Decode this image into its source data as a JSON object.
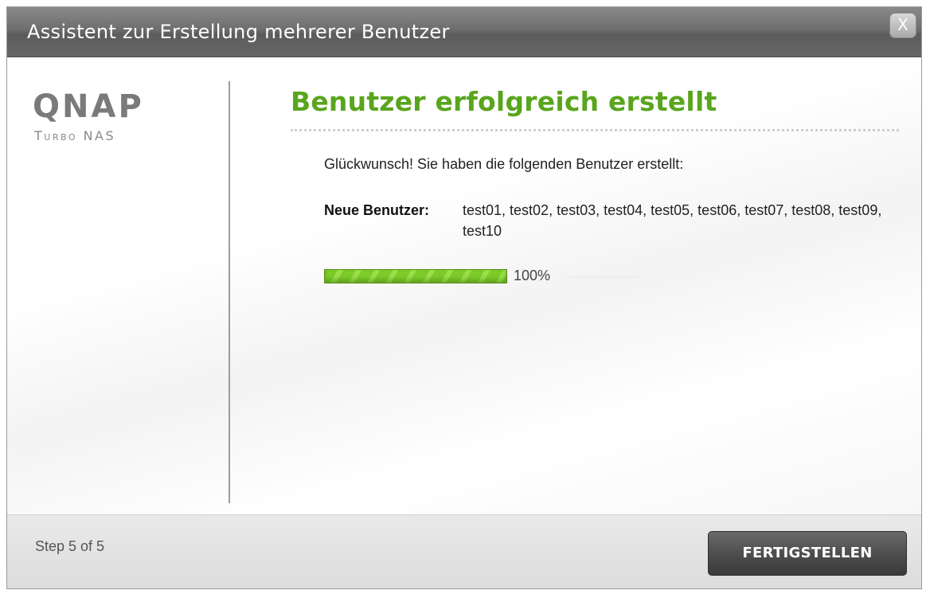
{
  "window": {
    "title": "Assistent zur Erstellung mehrerer Benutzer",
    "close_label": "X"
  },
  "sidebar": {
    "logo": "QNAP",
    "logo_sub": "Turbo NAS"
  },
  "main": {
    "heading": "Benutzer erfolgreich erstellt",
    "congrats": "Glückwunsch! Sie haben die folgenden Benutzer erstellt:",
    "users_label": "Neue Benutzer:",
    "users_value": "test01, test02, test03, test04, test05, test06, test07, test08, test09, test10",
    "progress": {
      "percent": 100,
      "label": "100%"
    }
  },
  "footer": {
    "step": "Step 5 of 5",
    "finish_label": "FERTIGSTELLEN"
  },
  "colors": {
    "accent_green": "#59a51d",
    "titlebar": "#6e6e6e",
    "button": "#4e4e4e"
  }
}
